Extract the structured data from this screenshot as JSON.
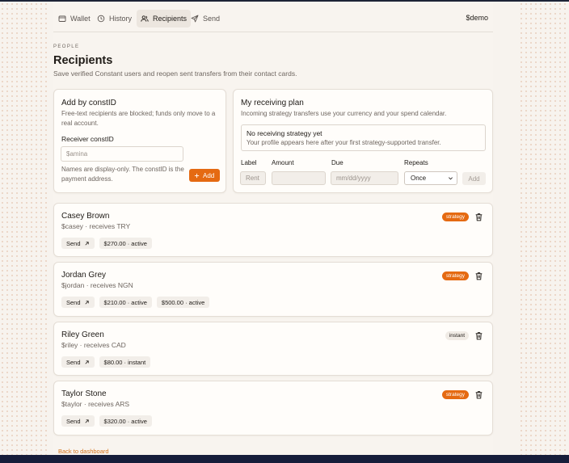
{
  "nav": {
    "items": [
      {
        "label": "Wallet",
        "icon": "wallet-icon"
      },
      {
        "label": "History",
        "icon": "history-icon"
      },
      {
        "label": "Recipients",
        "icon": "users-icon"
      },
      {
        "label": "Send",
        "icon": "send-icon"
      }
    ],
    "active": "Recipients",
    "account": "$demo"
  },
  "header": {
    "kicker": "PEOPLE",
    "title": "Recipients",
    "subtitle": "Save verified Constant users and reopen sent transfers from their contact cards."
  },
  "add_card": {
    "title": "Add by constID",
    "description": "Free-text recipients are blocked; funds only move to a real account.",
    "field_label": "Receiver constID",
    "placeholder": "$amina",
    "note": "Names are display-only. The constID is the payment address.",
    "button_label": "Add"
  },
  "plan_card": {
    "title": "My receiving plan",
    "description": "Incoming strategy transfers use your currency and your spend calendar.",
    "empty_title": "No receiving strategy yet",
    "empty_description": "Your profile appears here after your first strategy-supported transfer.",
    "label_label": "Label",
    "label_placeholder": "Rent",
    "amount_label": "Amount",
    "due_label": "Due",
    "due_placeholder": "mm/dd/yyyy",
    "repeats_label": "Repeats",
    "repeats_value": "Once",
    "add_label": "Add"
  },
  "recipients": [
    {
      "name": "Casey Brown",
      "detail": "$casey · receives TRY",
      "badge": "strategy",
      "send": "Send",
      "chips": [
        "$270.00 · active"
      ]
    },
    {
      "name": "Jordan Grey",
      "detail": "$jordan · receives NGN",
      "badge": "strategy",
      "send": "Send",
      "chips": [
        "$210.00 · active",
        "$500.00 · active"
      ]
    },
    {
      "name": "Riley Green",
      "detail": "$riley · receives CAD",
      "badge": "instant",
      "send": "Send",
      "chips": [
        "$80.00 · instant"
      ]
    },
    {
      "name": "Taylor Stone",
      "detail": "$taylor · receives ARS",
      "badge": "strategy",
      "send": "Send",
      "chips": [
        "$320.00 · active"
      ]
    }
  ],
  "footer": {
    "back_link": "Back to dashboard"
  },
  "colors": {
    "accent": "#e56a12",
    "background": "#f7f3ee",
    "card": "#fffdfa",
    "navy": "#161d3a"
  }
}
